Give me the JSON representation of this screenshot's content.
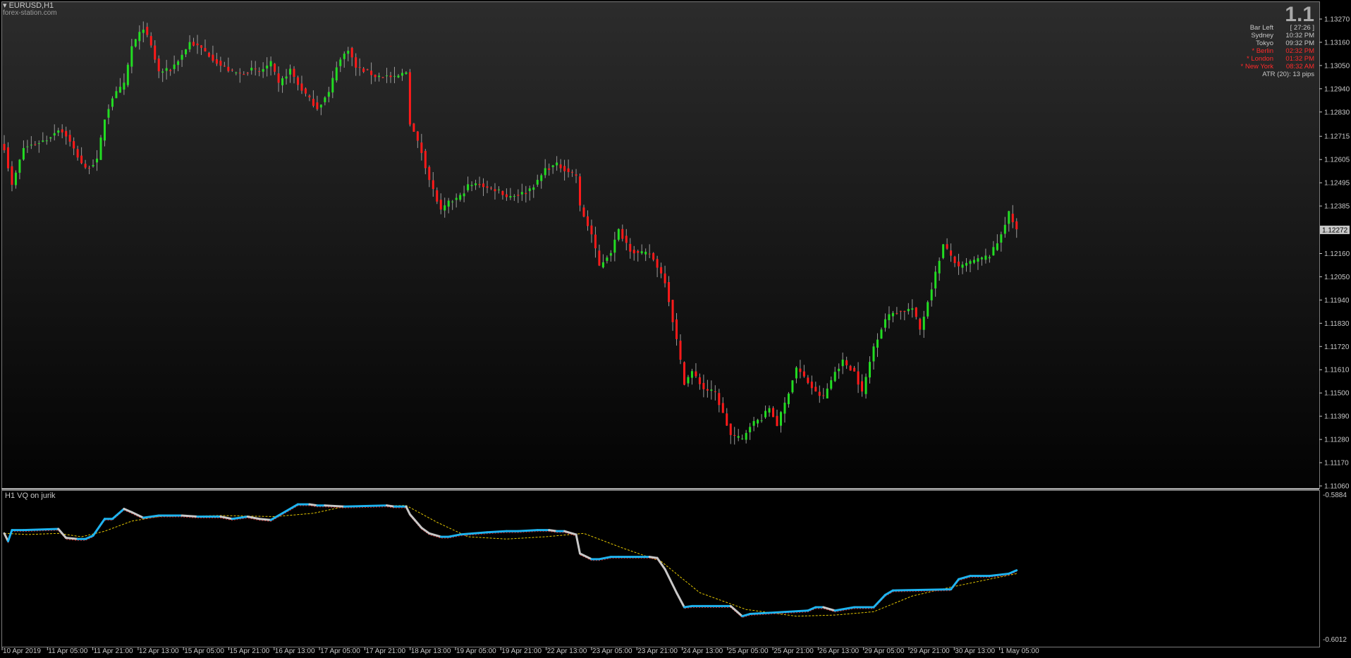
{
  "chart_header": {
    "symbol_label": "EURUSD,H1",
    "source_label": "forex-station.com",
    "big_value": "1.1"
  },
  "info_panel": {
    "rows": [
      {
        "label": "Bar Left",
        "value": "[ 27:26 ]",
        "color": "#c8c8c8"
      },
      {
        "label": "Sydney",
        "value": "10:32 PM",
        "color": "#c8c8c8"
      },
      {
        "label": "Tokyo",
        "value": "09:32 PM",
        "color": "#c8c8c8"
      },
      {
        "label": "* Berlin",
        "value": "02:32 PM",
        "color": "#ff2a2a"
      },
      {
        "label": "* London",
        "value": "01:32 PM",
        "color": "#ff2a2a"
      },
      {
        "label": "* New York",
        "value": "08:32 AM",
        "color": "#ff2a2a"
      }
    ],
    "atr": "ATR (20): 13 pips"
  },
  "price_axis": {
    "ticks": [
      "1.13270",
      "1.13160",
      "1.13050",
      "1.12940",
      "1.12830",
      "1.12715",
      "1.12605",
      "1.12495",
      "1.12385",
      "1.12160",
      "1.12050",
      "1.11940",
      "1.11830",
      "1.11720",
      "1.11610",
      "1.11500",
      "1.11390",
      "1.11280",
      "1.11170",
      "1.11060"
    ],
    "current_price": "1.12272"
  },
  "indicator": {
    "title": "H1 VQ on jurik",
    "top_value": "-0.5884",
    "bottom_value": "-0.6012"
  },
  "time_axis": {
    "labels": [
      "10 Apr 2019",
      "11 Apr 05:00",
      "11 Apr 21:00",
      "12 Apr 13:00",
      "15 Apr 05:00",
      "15 Apr 21:00",
      "16 Apr 13:00",
      "17 Apr 05:00",
      "17 Apr 21:00",
      "18 Apr 13:00",
      "19 Apr 05:00",
      "19 Apr 21:00",
      "22 Apr 13:00",
      "23 Apr 05:00",
      "23 Apr 21:00",
      "24 Apr 13:00",
      "25 Apr 05:00",
      "25 Apr 21:00",
      "26 Apr 13:00",
      "29 Apr 05:00",
      "29 Apr 21:00",
      "30 Apr 13:00",
      "1 May 05:00"
    ]
  },
  "colors": {
    "bull": "#22dd22",
    "bear": "#ff1a1a",
    "vq_up": "#1eb4f0",
    "vq_down": "#c8c8c8",
    "signal": "#e6c800",
    "signal2": "#c81e1e"
  },
  "chart_data": [
    {
      "type": "candlestick",
      "title": "EURUSD,H1",
      "ylim": [
        1.1106,
        1.1327
      ],
      "close_path": [
        [
          0,
          1.1266
        ],
        [
          2,
          1.1248
        ],
        [
          5,
          1.1266
        ],
        [
          11,
          1.127
        ],
        [
          14,
          1.1275
        ],
        [
          16,
          1.1272
        ],
        [
          19,
          1.1262
        ],
        [
          21,
          1.1256
        ],
        [
          24,
          1.126
        ],
        [
          26,
          1.128
        ],
        [
          28,
          1.129
        ],
        [
          31,
          1.1296
        ],
        [
          33,
          1.1314
        ],
        [
          36,
          1.1323
        ],
        [
          38,
          1.1314
        ],
        [
          40,
          1.1302
        ],
        [
          43,
          1.1303
        ],
        [
          46,
          1.131
        ],
        [
          48,
          1.1316
        ],
        [
          51,
          1.1313
        ],
        [
          53,
          1.131
        ],
        [
          56,
          1.1305
        ],
        [
          59,
          1.1302
        ],
        [
          61,
          1.1301
        ],
        [
          64,
          1.1303
        ],
        [
          66,
          1.1302
        ],
        [
          69,
          1.1306
        ],
        [
          71,
          1.1296
        ],
        [
          74,
          1.1303
        ],
        [
          76,
          1.1296
        ],
        [
          79,
          1.1289
        ],
        [
          81,
          1.1285
        ],
        [
          84,
          1.1292
        ],
        [
          86,
          1.1305
        ],
        [
          89,
          1.1313
        ],
        [
          91,
          1.1304
        ],
        [
          94,
          1.1302
        ],
        [
          96,
          1.13
        ],
        [
          99,
          1.13
        ],
        [
          101,
          1.1299
        ],
        [
          104,
          1.1302
        ],
        [
          105,
          1.1278
        ],
        [
          108,
          1.1264
        ],
        [
          110,
          1.1251
        ],
        [
          113,
          1.1236
        ],
        [
          115,
          1.124
        ],
        [
          118,
          1.1243
        ],
        [
          120,
          1.1248
        ],
        [
          123,
          1.1249
        ],
        [
          125,
          1.1247
        ],
        [
          128,
          1.1246
        ],
        [
          130,
          1.1243
        ],
        [
          133,
          1.1244
        ],
        [
          135,
          1.1245
        ],
        [
          138,
          1.125
        ],
        [
          140,
          1.1256
        ],
        [
          143,
          1.1258
        ],
        [
          145,
          1.1256
        ],
        [
          148,
          1.1253
        ],
        [
          149,
          1.1238
        ],
        [
          152,
          1.1225
        ],
        [
          154,
          1.121
        ],
        [
          157,
          1.1217
        ],
        [
          159,
          1.1227
        ],
        [
          162,
          1.1218
        ],
        [
          164,
          1.1216
        ],
        [
          167,
          1.1216
        ],
        [
          169,
          1.121
        ],
        [
          171,
          1.1203
        ],
        [
          174,
          1.1175
        ],
        [
          176,
          1.1155
        ],
        [
          178,
          1.116
        ],
        [
          181,
          1.1152
        ],
        [
          184,
          1.115
        ],
        [
          186,
          1.114
        ],
        [
          188,
          1.113
        ],
        [
          191,
          1.1128
        ],
        [
          193,
          1.1135
        ],
        [
          196,
          1.1138
        ],
        [
          198,
          1.1143
        ],
        [
          200,
          1.1135
        ],
        [
          202,
          1.1145
        ],
        [
          205,
          1.1162
        ],
        [
          208,
          1.1155
        ],
        [
          210,
          1.115
        ],
        [
          212,
          1.1148
        ],
        [
          215,
          1.116
        ],
        [
          217,
          1.1165
        ],
        [
          220,
          1.116
        ],
        [
          222,
          1.115
        ],
        [
          225,
          1.1172
        ],
        [
          228,
          1.1185
        ],
        [
          230,
          1.1188
        ],
        [
          233,
          1.1189
        ],
        [
          235,
          1.119
        ],
        [
          237,
          1.118
        ],
        [
          240,
          1.12
        ],
        [
          243,
          1.122
        ],
        [
          245,
          1.1215
        ],
        [
          247,
          1.1209
        ],
        [
          250,
          1.1212
        ],
        [
          252,
          1.1213
        ],
        [
          255,
          1.1215
        ],
        [
          257,
          1.1221
        ],
        [
          260,
          1.1235
        ],
        [
          262,
          1.1227
        ]
      ]
    },
    {
      "type": "line",
      "title": "H1 VQ on jurik",
      "ylim": [
        -0.6012,
        -0.5884
      ],
      "series": [
        {
          "values": [
            [
              0,
              -0.5917
            ],
            [
              1,
              -0.5924
            ],
            [
              2,
              -0.5914
            ],
            [
              5,
              -0.5914
            ],
            [
              14,
              -0.5913
            ],
            [
              16,
              -0.5921
            ],
            [
              19,
              -0.5922
            ],
            [
              21,
              -0.5922
            ],
            [
              23,
              -0.5919
            ],
            [
              26,
              -0.5904
            ],
            [
              28,
              -0.5904
            ],
            [
              31,
              -0.5895
            ],
            [
              33,
              -0.5898
            ],
            [
              36,
              -0.5903
            ],
            [
              40,
              -0.5901
            ],
            [
              46,
              -0.5901
            ],
            [
              50,
              -0.5902
            ],
            [
              56,
              -0.5902
            ],
            [
              59,
              -0.5904
            ],
            [
              63,
              -0.5902
            ],
            [
              66,
              -0.5904
            ],
            [
              69,
              -0.5905
            ],
            [
              71,
              -0.5901
            ],
            [
              76,
              -0.5891
            ],
            [
              79,
              -0.5891
            ],
            [
              81,
              -0.5892
            ],
            [
              83,
              -0.5892
            ],
            [
              88,
              -0.5893
            ],
            [
              99,
              -0.5892
            ],
            [
              101,
              -0.5893
            ],
            [
              104,
              -0.5893
            ],
            [
              105,
              -0.59
            ],
            [
              108,
              -0.5912
            ],
            [
              110,
              -0.5917
            ],
            [
              113,
              -0.592
            ],
            [
              115,
              -0.592
            ],
            [
              118,
              -0.5918
            ],
            [
              125,
              -0.5916
            ],
            [
              130,
              -0.5915
            ],
            [
              133,
              -0.5915
            ],
            [
              138,
              -0.5914
            ],
            [
              141,
              -0.5914
            ],
            [
              143,
              -0.5915
            ],
            [
              145,
              -0.5915
            ],
            [
              148,
              -0.5918
            ],
            [
              149,
              -0.5935
            ],
            [
              152,
              -0.594
            ],
            [
              154,
              -0.594
            ],
            [
              157,
              -0.5938
            ],
            [
              159,
              -0.5938
            ],
            [
              167,
              -0.5938
            ],
            [
              169,
              -0.5939
            ],
            [
              171,
              -0.5949
            ],
            [
              174,
              -0.597
            ],
            [
              176,
              -0.5983
            ],
            [
              178,
              -0.5982
            ],
            [
              188,
              -0.5982
            ],
            [
              191,
              -0.5991
            ],
            [
              193,
              -0.5989
            ],
            [
              198,
              -0.5988
            ],
            [
              208,
              -0.5986
            ],
            [
              210,
              -0.5983
            ],
            [
              212,
              -0.5983
            ],
            [
              215,
              -0.5986
            ],
            [
              220,
              -0.5983
            ],
            [
              225,
              -0.5983
            ],
            [
              228,
              -0.5972
            ],
            [
              230,
              -0.5968
            ],
            [
              245,
              -0.5967
            ],
            [
              247,
              -0.5958
            ],
            [
              250,
              -0.5955
            ],
            [
              255,
              -0.5955
            ],
            [
              260,
              -0.5953
            ],
            [
              262,
              -0.595
            ]
          ]
        },
        {
          "values": [
            [
              0,
              -0.5917
            ],
            [
              6,
              -0.5918
            ],
            [
              14,
              -0.5917
            ],
            [
              20,
              -0.592
            ],
            [
              26,
              -0.5915
            ],
            [
              33,
              -0.5906
            ],
            [
              40,
              -0.5902
            ],
            [
              56,
              -0.5901
            ],
            [
              70,
              -0.5902
            ],
            [
              80,
              -0.5899
            ],
            [
              88,
              -0.5893
            ],
            [
              104,
              -0.5892
            ],
            [
              112,
              -0.5907
            ],
            [
              120,
              -0.592
            ],
            [
              130,
              -0.5922
            ],
            [
              140,
              -0.592
            ],
            [
              150,
              -0.5917
            ],
            [
              160,
              -0.593
            ],
            [
              170,
              -0.5942
            ],
            [
              180,
              -0.597
            ],
            [
              192,
              -0.5985
            ],
            [
              205,
              -0.5991
            ],
            [
              215,
              -0.599
            ],
            [
              225,
              -0.5987
            ],
            [
              235,
              -0.5973
            ],
            [
              245,
              -0.5965
            ],
            [
              262,
              -0.5953
            ]
          ]
        }
      ]
    }
  ]
}
